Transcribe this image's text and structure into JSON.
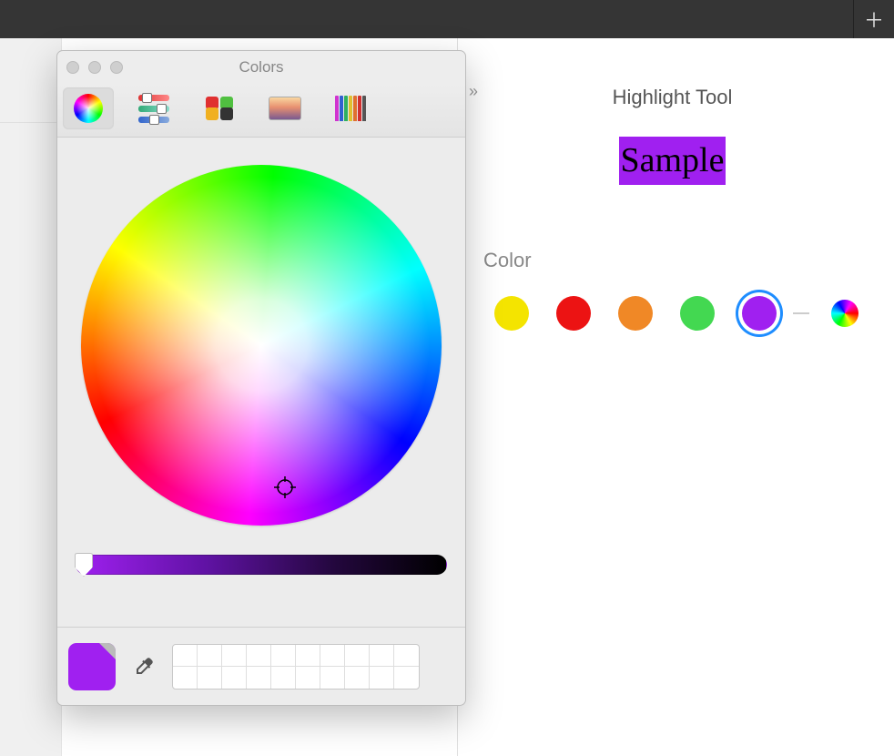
{
  "topbar": {
    "new_tab_glyph": "＋"
  },
  "panel": {
    "collapse_glyph": "»",
    "title": "Highlight Tool",
    "sample_text": "Sample",
    "sample_highlight_color": "#a020f0",
    "color_label": "Color",
    "swatches": [
      {
        "name": "yellow",
        "hex": "#f4e400",
        "selected": false
      },
      {
        "name": "red",
        "hex": "#ec1313",
        "selected": false
      },
      {
        "name": "orange",
        "hex": "#f08826",
        "selected": false
      },
      {
        "name": "green",
        "hex": "#43d851",
        "selected": false
      },
      {
        "name": "purple",
        "hex": "#a020f0",
        "selected": true
      }
    ],
    "custom_swatch": "custom"
  },
  "picker": {
    "title": "Colors",
    "active_tab": "wheel",
    "tabs": [
      "wheel",
      "sliders",
      "palette",
      "image",
      "pencils"
    ],
    "wheel": {
      "cursor_hint": "crosshair",
      "selected_color": "#a020f0"
    },
    "brightness": {
      "value_percent": 0
    },
    "footer": {
      "current_color": "#a020f0",
      "eyedropper": "eyedropper",
      "saved_swatch_count": 20
    }
  }
}
